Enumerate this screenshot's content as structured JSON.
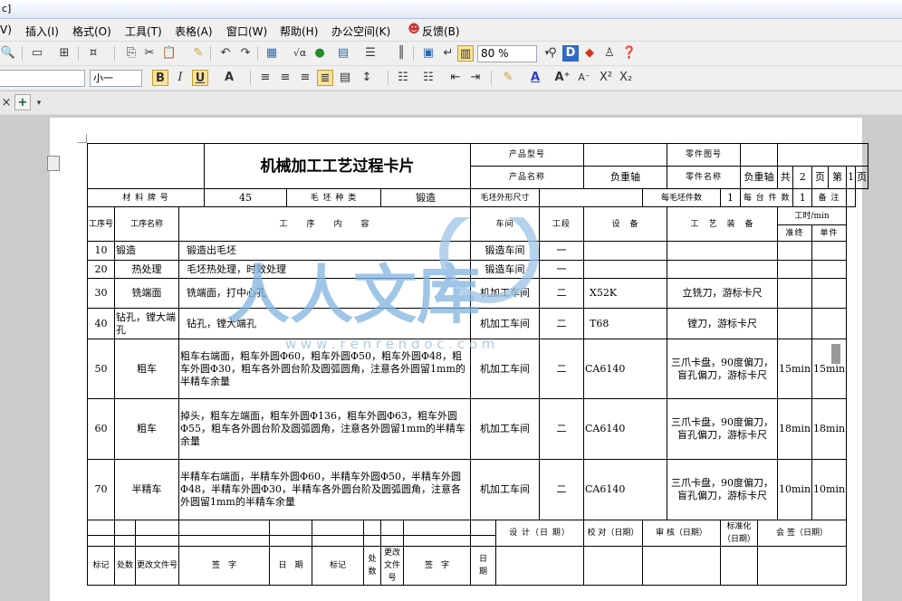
{
  "window": {
    "title_fragment": "c]"
  },
  "menubar": [
    {
      "id": "view",
      "label": "V)"
    },
    {
      "id": "insert",
      "label": "插入(I)"
    },
    {
      "id": "format",
      "label": "格式(O)"
    },
    {
      "id": "tools",
      "label": "工具(T)"
    },
    {
      "id": "table",
      "label": "表格(A)"
    },
    {
      "id": "window",
      "label": "窗口(W)"
    },
    {
      "id": "help",
      "label": "帮助(H)"
    },
    {
      "id": "office",
      "label": "办公空间(K)"
    },
    {
      "id": "feedback",
      "label": "反馈(B)"
    }
  ],
  "toolbar": {
    "zoom": "80 %",
    "font_size": "小一",
    "underline": "U",
    "bold": "B",
    "italic": "I",
    "annotation_a": "A",
    "sup": "X²",
    "sub": "X₂"
  },
  "card": {
    "title": "机械加工工艺过程卡片",
    "product_model_label": "产品型号",
    "product_model": "",
    "part_drawing_label": "零件图号",
    "part_drawing": "",
    "product_name_label": "产品名称",
    "product_name": "负重轴",
    "part_name_label": "零件名称",
    "part_name": "负重轴",
    "total_label": "共",
    "total": "2",
    "page_unit": "页",
    "page_label": "第",
    "page": "1",
    "page_unit2": "页",
    "material_label": "材 料 牌 号",
    "material": "45",
    "blank_type_label": "毛 坯 种 类",
    "blank_type": "锻造",
    "blank_size_label": "毛坯外形尺寸",
    "blank_size": "",
    "per_blank_label": "每毛坯件数",
    "per_blank": "1",
    "per_unit_label": "每 台 件 数",
    "per_unit": "1",
    "remark_label": "备 注",
    "remark": "",
    "headers": {
      "seq": "工序号",
      "name": "工序名称",
      "content": "工　　序　　内　　容",
      "workshop": "车间",
      "section": "工段",
      "equipment": "设　备",
      "tooling": "工　艺　装　备",
      "time": "工时/min",
      "prep": "准终",
      "unit": "单件"
    },
    "rows": [
      {
        "seq": "10",
        "name": "锻造",
        "content": "锻造出毛坯",
        "workshop": "锻造车间",
        "section": "一",
        "equipment": "",
        "tooling": "",
        "prep": "",
        "unit": ""
      },
      {
        "seq": "20",
        "name": "热处理",
        "content": "毛坯热处理，时效处理",
        "workshop": "锻造车间",
        "section": "一",
        "equipment": "",
        "tooling": "",
        "prep": "",
        "unit": ""
      },
      {
        "seq": "30",
        "name": "铣端面",
        "content": "铣端面，打中心孔",
        "workshop": "机加工车间",
        "section": "二",
        "equipment": "X52K",
        "tooling": "立铣刀，游标卡尺",
        "prep": "",
        "unit": ""
      },
      {
        "seq": "40",
        "name": "钻孔，镗大端孔",
        "content": "钻孔，镗大端孔",
        "workshop": "机加工车间",
        "section": "二",
        "equipment": "T68",
        "tooling": "镗刀，游标卡尺",
        "prep": "",
        "unit": ""
      },
      {
        "seq": "50",
        "name": "粗车",
        "content": "粗车右端面，粗车外圆Φ60，粗车外圆Φ50，粗车外圆Φ48，粗车外圆Φ30，粗车各外圆台阶及圆弧圆角，注意各外圆留1mm的半精车余量",
        "workshop": "机加工车间",
        "section": "二",
        "equipment": "CA6140",
        "tooling": "三爪卡盘，90度偏刀，盲孔偏刀，游标卡尺",
        "prep": "15min",
        "unit": "15min"
      },
      {
        "seq": "60",
        "name": "粗车",
        "content": "掉头，粗车左端面，粗车外圆Φ136，粗车外圆Φ63，粗车外圆Φ55，粗车各外圆台阶及圆弧圆角，注意各外圆留1mm的半精车余量",
        "workshop": "机加工车间",
        "section": "二",
        "equipment": "CA6140",
        "tooling": "三爪卡盘，90度偏刀，盲孔偏刀，游标卡尺",
        "prep": "18min",
        "unit": "18min"
      },
      {
        "seq": "70",
        "name": "半精车",
        "content": "半精车右端面，半精车外圆Φ60，半精车外圆Φ50，半精车外圆Φ48，半精车外圆Φ30，半精车各外圆台阶及圆弧圆角，注意各外圆留1mm的半精车余量",
        "workshop": "机加工车间",
        "section": "二",
        "equipment": "CA6140",
        "tooling": "三爪卡盘，90度偏刀，盲孔偏刀，游标卡尺",
        "prep": "10min",
        "unit": "10min"
      }
    ],
    "footer": {
      "design": "设 计（日 期）",
      "check": "校 对（日期）",
      "review": "审 核（日期）",
      "standard": "标准化（日期）",
      "sign": "会 签（日期）",
      "mark": "标记",
      "count": "处数",
      "doc": "更改文件号",
      "signature": "签　字",
      "date": "日　期"
    }
  },
  "watermark": {
    "url": "w w w . r e n r e n d o c . c o m"
  }
}
